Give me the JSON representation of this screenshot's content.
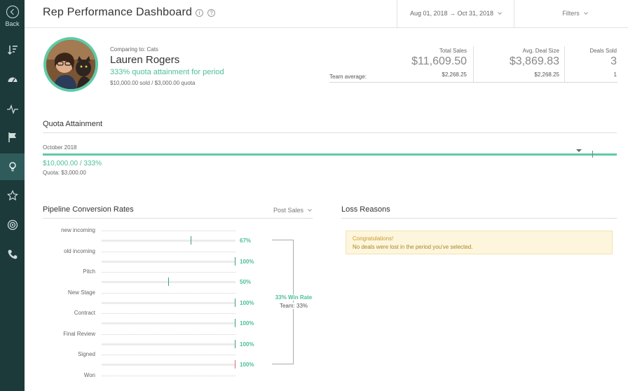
{
  "sidebar": {
    "back_label": "Back",
    "items": [
      {
        "icon": "sort-icon"
      },
      {
        "icon": "dashboard-icon"
      },
      {
        "icon": "activity-icon"
      },
      {
        "icon": "flag-icon"
      },
      {
        "icon": "lightbulb-icon",
        "active": true
      },
      {
        "icon": "star-icon"
      },
      {
        "icon": "target-icon"
      },
      {
        "icon": "phone-icon"
      }
    ]
  },
  "header": {
    "title": "Rep Performance Dashboard",
    "info_glyph": "i",
    "help_glyph": "?",
    "date_range": "Aug 01, 2018 → Oct 31, 2018",
    "filters_label": "Filters"
  },
  "profile": {
    "comparing": "Comparing to: Cats",
    "name": "Lauren Rogers",
    "quota_attainment": "333% quota attainment for period",
    "sold_summary": "$10,000.00 sold / $3,000.00 quota"
  },
  "stats": {
    "team_average_label": "Team average:",
    "items": [
      {
        "label": "Total Sales",
        "value": "$11,609.50",
        "team_avg": "$2,268.25"
      },
      {
        "label": "Avg. Deal Size",
        "value": "$3,869.83",
        "team_avg": "$2,268.25"
      },
      {
        "label": "Deals Sold",
        "value": "3",
        "team_avg": "1"
      }
    ]
  },
  "quota": {
    "title": "Quota Attainment",
    "month": "October 2018",
    "amount": "$10,000.00 / 333%",
    "quota_line": "Quota: $3,000.00"
  },
  "pipeline": {
    "title": "Pipeline Conversion Rates",
    "filter_label": "Post Sales",
    "stages": [
      "new incoming",
      "old incoming",
      "Pitch",
      "New Stage",
      "Contract",
      "Final Review",
      "Signed",
      "Won"
    ],
    "conversions": [
      {
        "label": "67%",
        "value": 0.67
      },
      {
        "label": "100%",
        "value": 1.0
      },
      {
        "label": "50%",
        "value": 0.5
      },
      {
        "label": "100%",
        "value": 1.0
      },
      {
        "label": "100%",
        "value": 1.0
      },
      {
        "label": "100%",
        "value": 1.0
      },
      {
        "label": "100%",
        "value": 1.0
      }
    ],
    "win_rate": "33% Win Rate",
    "team_rate": "Team: 33%"
  },
  "loss_reasons": {
    "title": "Loss Reasons",
    "notice_title": "Congratulations!",
    "notice_text": "No deals were lost in the period you've selected."
  },
  "colors": {
    "sidebar_bg": "#1c3a3a",
    "sidebar_active": "#2f5b5b",
    "accent_green": "#4cbf96",
    "notice_bg": "#fdf6dc"
  }
}
